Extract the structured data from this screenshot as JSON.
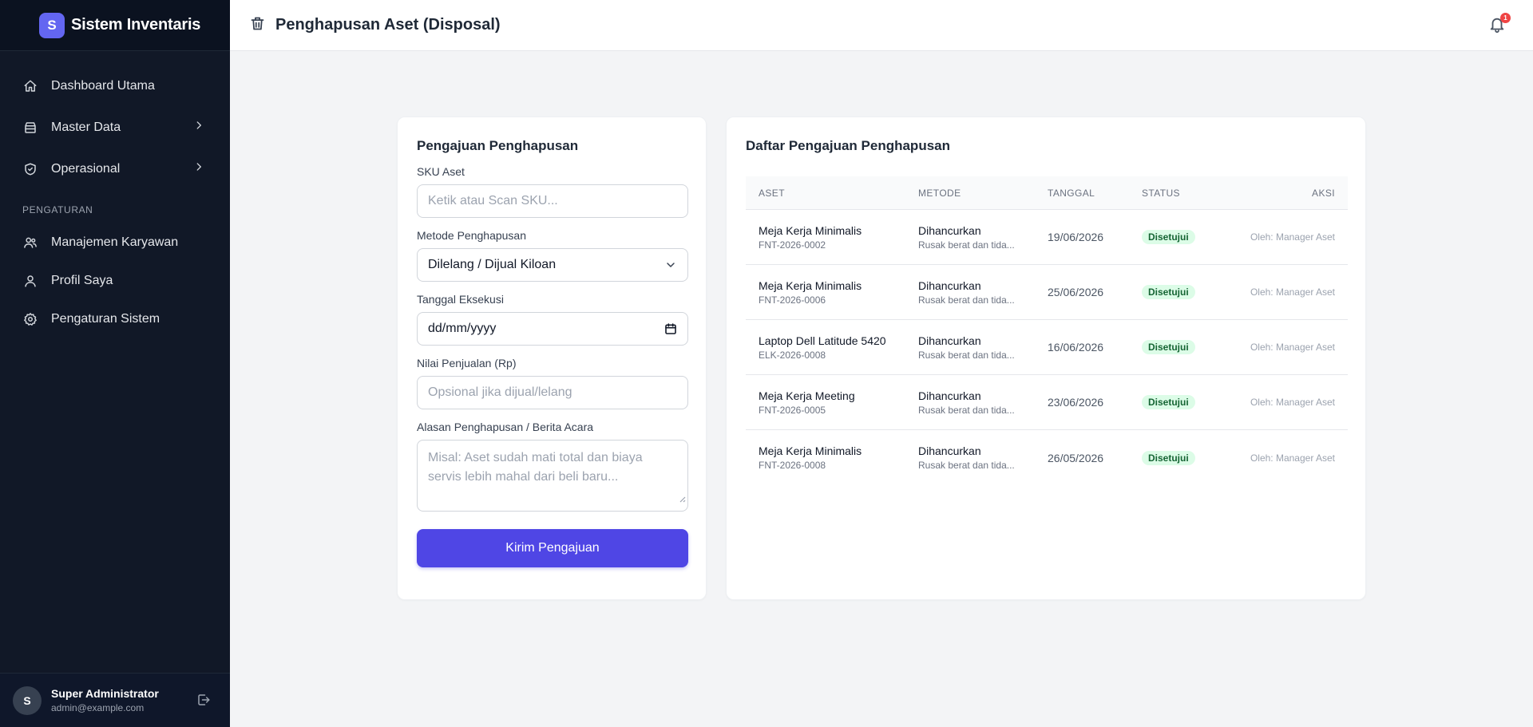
{
  "app": {
    "logo_letter": "S",
    "title": "Sistem Inventaris"
  },
  "sidebar": {
    "items": [
      {
        "label": "Dashboard Utama",
        "icon": "home-icon"
      },
      {
        "label": "Master Data",
        "icon": "archive-icon"
      },
      {
        "label": "Operasional",
        "icon": "shield-icon"
      }
    ],
    "section_label": "PENGATURAN",
    "settings_items": [
      {
        "label": "Manajemen Karyawan",
        "icon": "users-icon"
      },
      {
        "label": "Profil Saya",
        "icon": "user-icon"
      },
      {
        "label": "Pengaturan Sistem",
        "icon": "gear-icon"
      }
    ]
  },
  "user": {
    "initial": "S",
    "name": "Super Administrator",
    "email": "admin@example.com"
  },
  "header": {
    "title": "Penghapusan Aset (Disposal)",
    "notification_count": "1"
  },
  "form": {
    "title": "Pengajuan Penghapusan",
    "sku_label": "SKU Aset",
    "sku_placeholder": "Ketik atau Scan SKU...",
    "method_label": "Metode Penghapusan",
    "method_value": "Dilelang / Dijual Kiloan",
    "date_label": "Tanggal Eksekusi",
    "date_placeholder": "dd/mm/yyyy",
    "price_label": "Nilai Penjualan (Rp)",
    "price_placeholder": "Opsional jika dijual/lelang",
    "reason_label": "Alasan Penghapusan / Berita Acara",
    "reason_placeholder": "Misal: Aset sudah mati total dan biaya servis lebih mahal dari beli baru...",
    "submit_label": "Kirim Pengajuan"
  },
  "list": {
    "title": "Daftar Pengajuan Penghapusan",
    "columns": [
      "ASET",
      "METODE",
      "TANGGAL",
      "STATUS",
      "AKSI"
    ],
    "rows": [
      {
        "asset": "Meja Kerja Minimalis",
        "sku": "FNT-2026-0002",
        "method": "Dihancurkan",
        "note": "Rusak berat dan tida...",
        "date": "19/06/2026",
        "status": "Disetujui",
        "action": "Oleh: Manager Aset"
      },
      {
        "asset": "Meja Kerja Minimalis",
        "sku": "FNT-2026-0006",
        "method": "Dihancurkan",
        "note": "Rusak berat dan tida...",
        "date": "25/06/2026",
        "status": "Disetujui",
        "action": "Oleh: Manager Aset"
      },
      {
        "asset": "Laptop Dell Latitude 5420",
        "sku": "ELK-2026-0008",
        "method": "Dihancurkan",
        "note": "Rusak berat dan tida...",
        "date": "16/06/2026",
        "status": "Disetujui",
        "action": "Oleh: Manager Aset"
      },
      {
        "asset": "Meja Kerja Meeting",
        "sku": "FNT-2026-0005",
        "method": "Dihancurkan",
        "note": "Rusak berat dan tida...",
        "date": "23/06/2026",
        "status": "Disetujui",
        "action": "Oleh: Manager Aset"
      },
      {
        "asset": "Meja Kerja Minimalis",
        "sku": "FNT-2026-0008",
        "method": "Dihancurkan",
        "note": "Rusak berat dan tida...",
        "date": "26/05/2026",
        "status": "Disetujui",
        "action": "Oleh: Manager Aset"
      }
    ]
  },
  "colors": {
    "sidebar_bg": "#111827",
    "accent": "#4f46e5",
    "status_bg": "#dcfce7",
    "status_text": "#166534",
    "notification": "#ef4444"
  }
}
